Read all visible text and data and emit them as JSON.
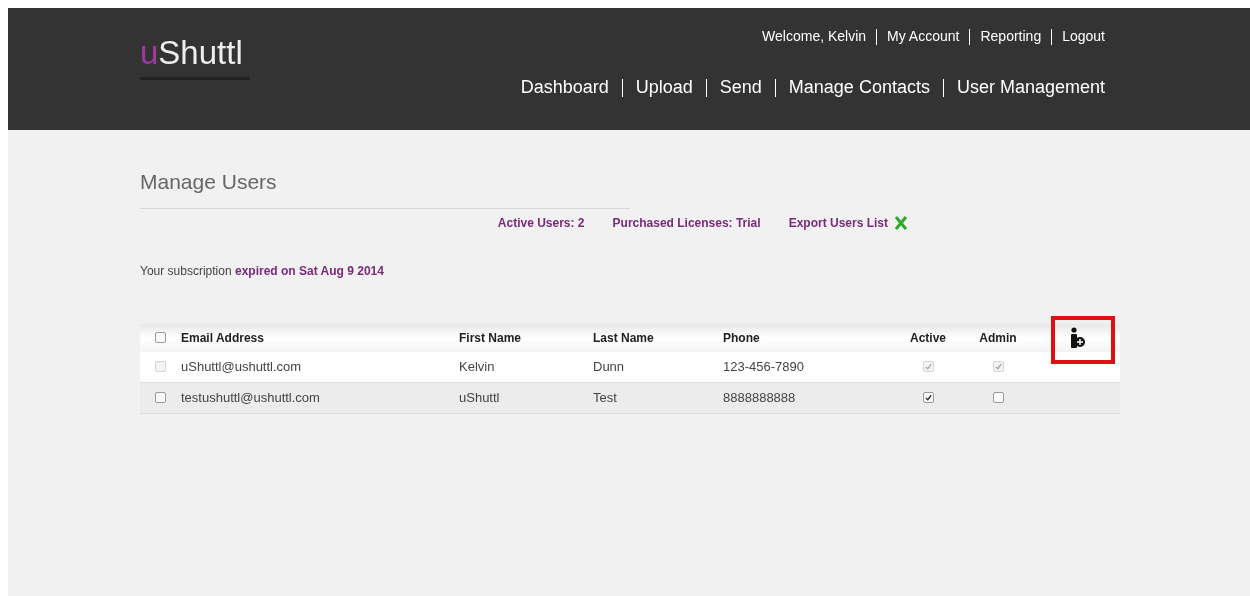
{
  "header": {
    "logo": {
      "accent": "u",
      "rest": "Shuttl"
    },
    "top_links": [
      "Welcome, Kelvin",
      "My Account",
      "Reporting",
      "Logout"
    ],
    "nav": [
      "Dashboard",
      "Upload",
      "Send",
      "Manage Contacts",
      "User Management"
    ]
  },
  "page": {
    "title": "Manage Users",
    "stats": [
      "Active Users: 2",
      "Purchased Licenses: Trial"
    ],
    "export_link": "Export Users List",
    "subscription": {
      "prefix": "Your subscription",
      "status": "expired on Sat Aug 9 2014"
    }
  },
  "table": {
    "select_all": {
      "checked": false,
      "disabled": false
    },
    "columns": [
      "Email Address",
      "First Name",
      "Last Name",
      "Phone",
      "Active",
      "Admin"
    ],
    "rows": [
      {
        "email": "uShuttl@ushuttl.com",
        "first": "Kelvin",
        "last": "Dunn",
        "phone": "123-456-7890",
        "selected": false,
        "disabled": true,
        "active": true,
        "admin": true
      },
      {
        "email": "testushuttl@ushuttl.com",
        "first": "uShuttl",
        "last": "Test",
        "phone": "8888888888",
        "selected": false,
        "disabled": false,
        "active": true,
        "admin": false
      }
    ]
  }
}
